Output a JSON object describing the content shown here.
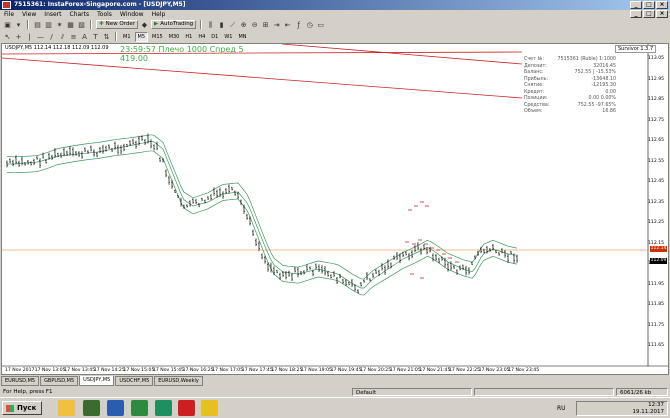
{
  "window": {
    "title": "7515361: InstaForex-Singapore.com - [USDJPY,M5]"
  },
  "menu": [
    "File",
    "View",
    "Insert",
    "Charts",
    "Tools",
    "Window",
    "Help"
  ],
  "toolbar": {
    "new_order": "New Order",
    "autotrading": "AutoTrading"
  },
  "timeframes": [
    "M1",
    "M5",
    "M15",
    "M30",
    "H1",
    "H4",
    "D1",
    "W1",
    "MN"
  ],
  "active_timeframe": "M5",
  "chart": {
    "symbol_line": "USDJPY,M5  112.14 112.18 112.09 112.09",
    "timer_text": "23:59:57 Плечо 1000 Спред 5",
    "price_text": "419.00",
    "survivor": "Survivor 1.3.7",
    "account": [
      {
        "label": "Счет №:",
        "value": "7515361 (Ruble) 1:1000"
      },
      {
        "label": "Депозит:",
        "value": "32016.45"
      },
      {
        "label": "Баланс:",
        "value": "752.55 | -15.53%"
      },
      {
        "label": "Прибыль:",
        "value": "-13648.10"
      },
      {
        "label": "Снятие:",
        "value": "-12195.30"
      },
      {
        "label": "Кредит:",
        "value": "0.00"
      },
      {
        "label": "Позиции:",
        "value": "0.00   0.00%"
      },
      {
        "label": "Средства:",
        "value": "752.55   -97.65%"
      },
      {
        "label": "Объем:",
        "value": "16.86"
      }
    ],
    "y_labels": [
      "113.05",
      "112.95",
      "112.85",
      "112.75",
      "112.65",
      "112.55",
      "112.45",
      "112.35",
      "112.25",
      "112.15",
      "112.09",
      "111.95",
      "111.85",
      "111.75",
      "111.65"
    ],
    "price_tags": [
      {
        "text": "112.14",
        "color": "#cc3300"
      },
      {
        "text": "112.09",
        "color": "#000000"
      }
    ],
    "x_labels": [
      "17 Nov 2017",
      "17 Nov 13:05",
      "17 Nov 13:45",
      "17 Nov 14:25",
      "17 Nov 15:05",
      "17 Nov 15:45",
      "17 Nov 16:25",
      "17 Nov 17:05",
      "17 Nov 17:45",
      "17 Nov 18:25",
      "17 Nov 19:05",
      "17 Nov 19:45",
      "17 Nov 20:25",
      "17 Nov 21:05",
      "17 Nov 21:45",
      "17 Nov 22:25",
      "17 Nov 23:05",
      "17 Nov 23:45"
    ],
    "colors": {
      "ma": "#3a9a5a",
      "redline": "#cc2222",
      "bid_line": "#e07a2e",
      "bars": "#000000"
    }
  },
  "tabs": [
    "EURUSD,M5",
    "GBPUSD,M5",
    "USDJPY,M5",
    "USDCHF,M5",
    "EURUSD,Weekly"
  ],
  "active_tab": "USDJPY,M5",
  "status": {
    "help": "For Help, press F1",
    "profile": "Default",
    "traffic": "6061/26 kb"
  },
  "taskbar": {
    "start": "Пуск",
    "lang": "RU",
    "time": "12:37",
    "date": "19.11.2017"
  }
}
